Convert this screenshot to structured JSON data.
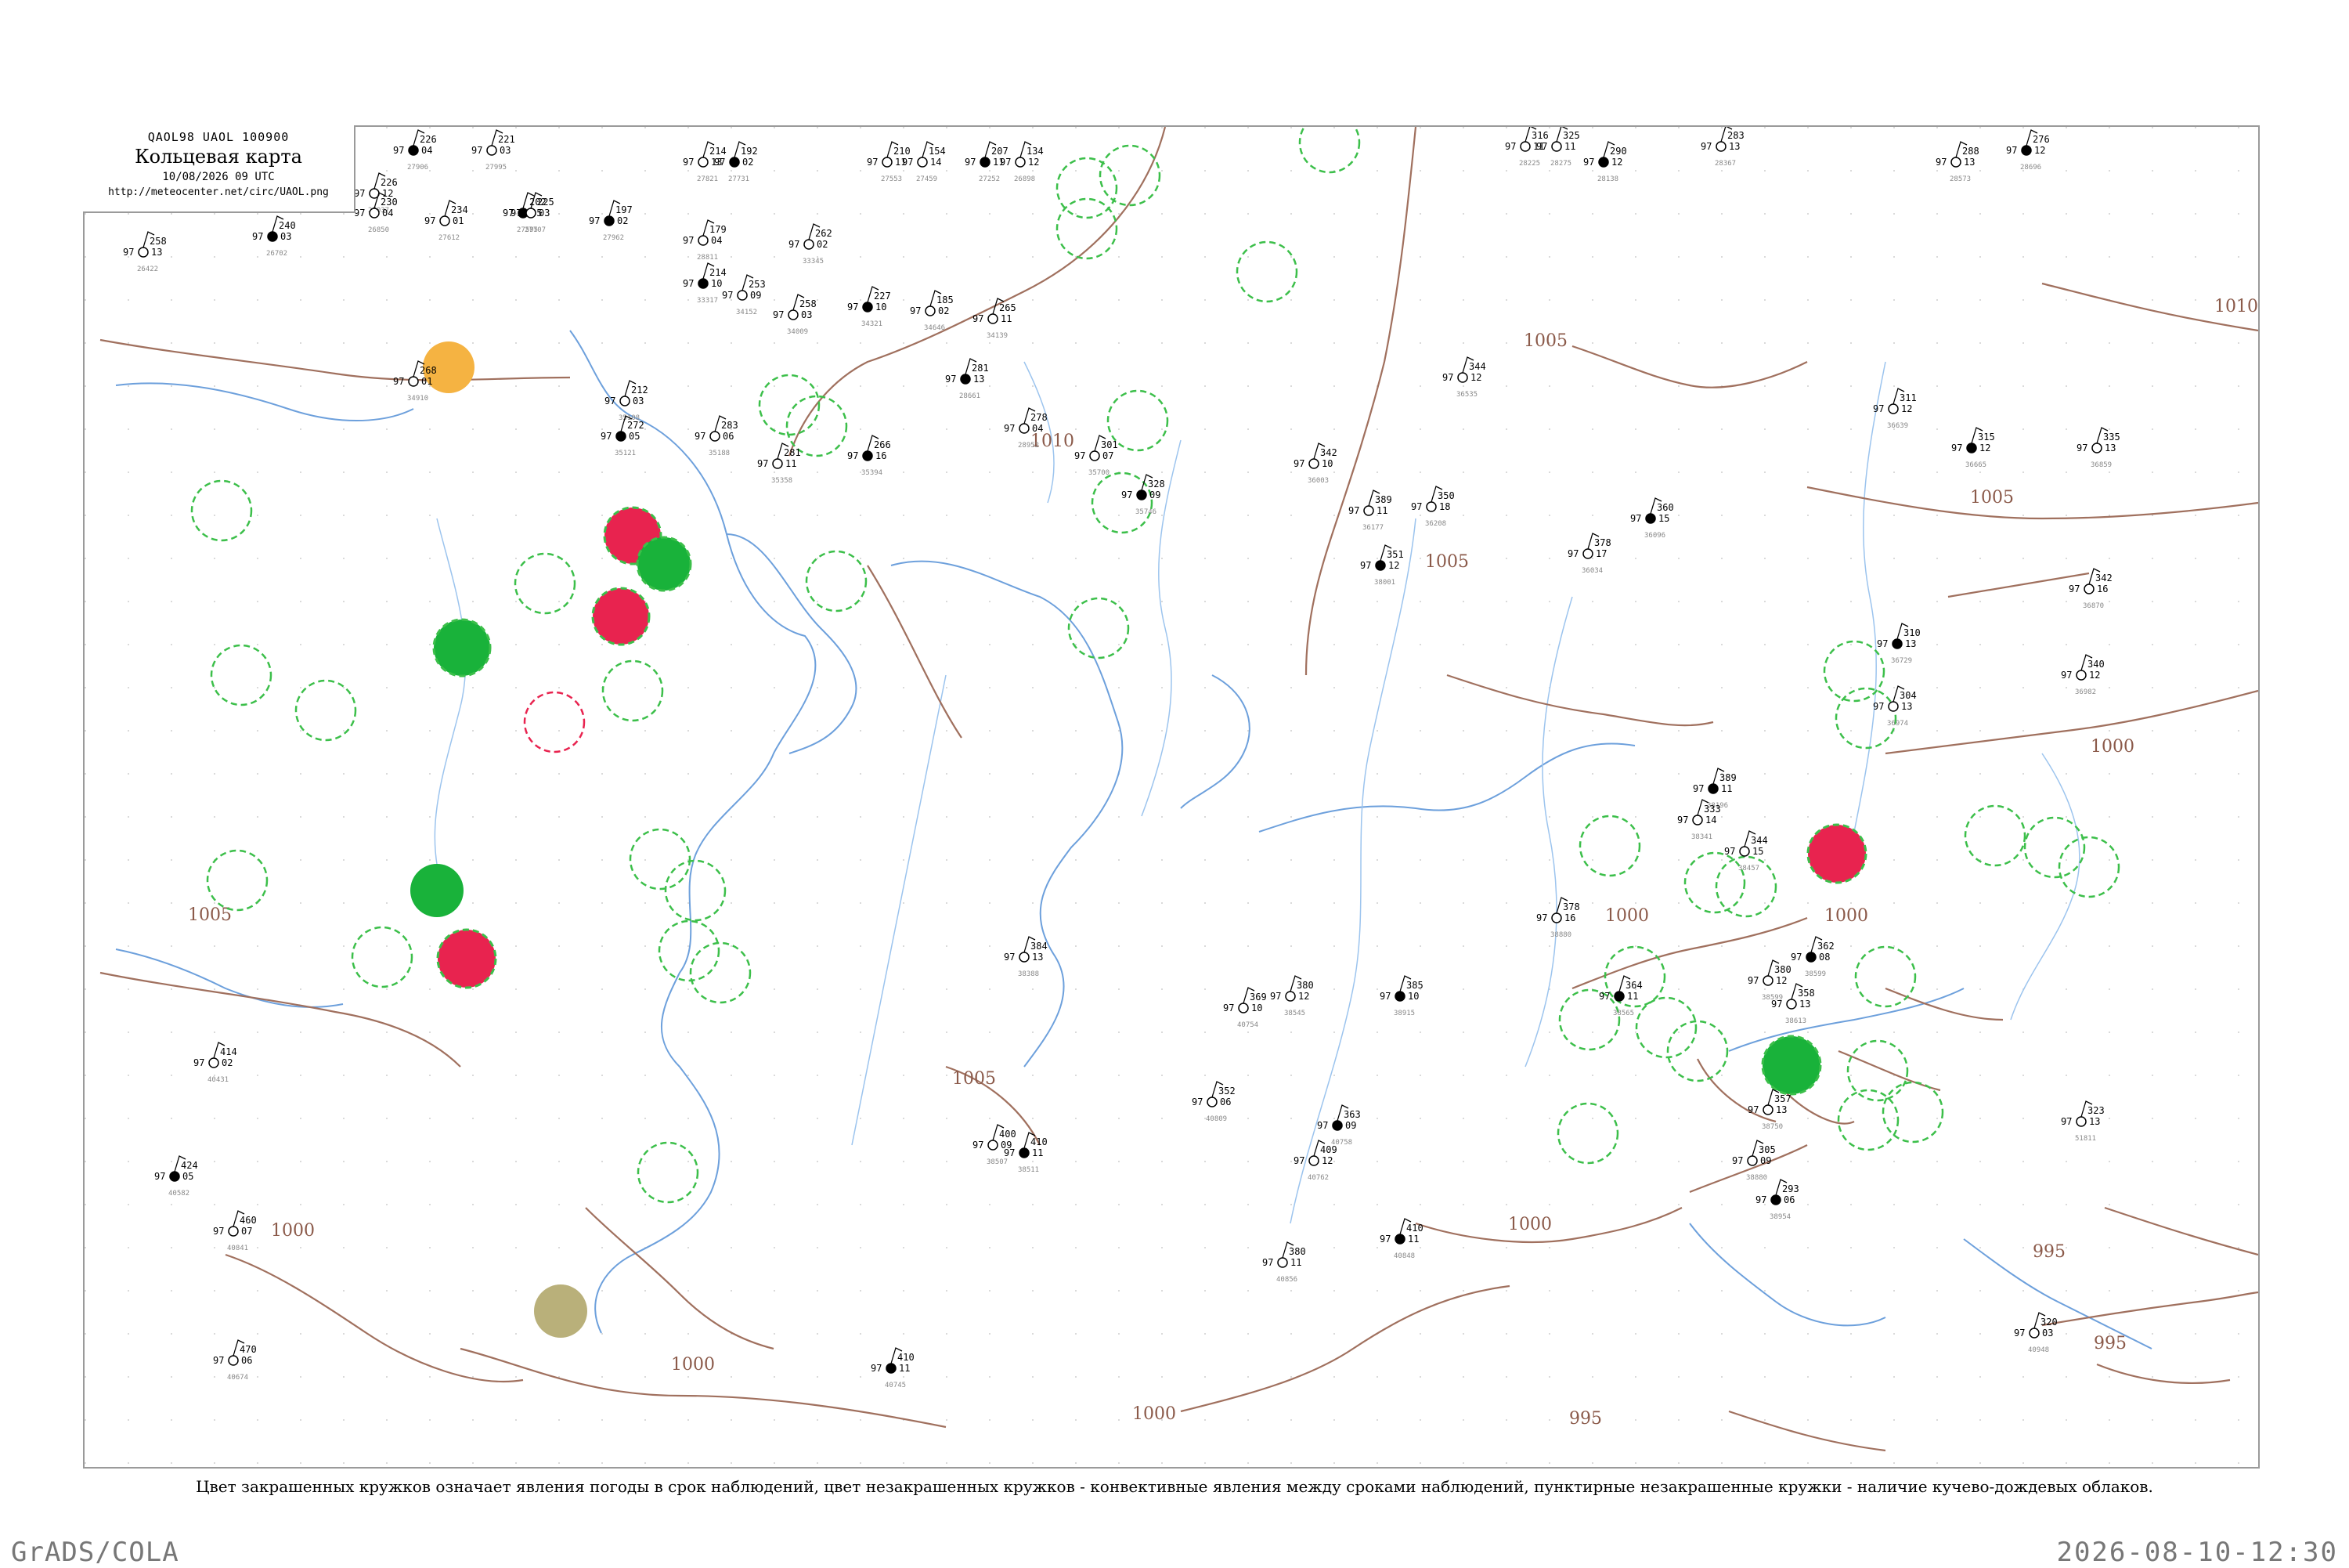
{
  "header": {
    "codes": "QAOL98  UAOL  100900",
    "title": "Кольцевая карта",
    "datetime": "10/08/2026 09 UTC",
    "url": "http://meteocenter.net/circ/UAOL.png"
  },
  "caption": "Цвет закрашенных кружков означает явления погоды в срок наблюдений, цвет незакрашенных кружков - конвективные явления между сроками наблюдений, пунктирные незакрашенные кружки - наличие кучево-дождевых облаков.",
  "footer": {
    "software": "GrADS/COLA",
    "timestamp": "2026-08-10-12:30"
  },
  "colors": {
    "isobar": "#a0705e",
    "river": "#7fb2e8",
    "coast": "#6da0dc",
    "thunder_fill": "#e8234f",
    "shower_fill": "#19b23a",
    "haze_fill": "#f5b342",
    "dust_fill": "#b9b07a",
    "cb_ring": "#3cbf4a"
  },
  "isobars": [
    {
      "label": "1010"
    },
    {
      "label": "1005"
    },
    {
      "label": "1005"
    },
    {
      "label": "1005"
    },
    {
      "label": "1005"
    },
    {
      "label": "1000"
    },
    {
      "label": "1000"
    },
    {
      "label": "1000"
    },
    {
      "label": "1000"
    },
    {
      "label": "1000"
    },
    {
      "label": "1000"
    },
    {
      "label": "995"
    },
    {
      "label": "995"
    },
    {
      "label": "995"
    },
    {
      "label": "1010"
    },
    {
      "label": "1005"
    },
    {
      "label": "1000"
    }
  ],
  "stations": [
    {
      "pressure": "226",
      "temp": "97",
      "dew": "04",
      "id": "27906"
    },
    {
      "pressure": "221",
      "temp": "97",
      "dew": "03",
      "id": "27995"
    },
    {
      "pressure": "214",
      "temp": "97",
      "dew": "13",
      "id": "27821"
    },
    {
      "pressure": "192",
      "temp": "97",
      "dew": "02",
      "id": "27731"
    },
    {
      "pressure": "210",
      "temp": "97",
      "dew": "11",
      "id": "27553"
    },
    {
      "pressure": "154",
      "temp": "97",
      "dew": "14",
      "id": "27459"
    },
    {
      "pressure": "207",
      "temp": "97",
      "dew": "11",
      "id": "27252"
    },
    {
      "pressure": "134",
      "temp": "97",
      "dew": "12",
      "id": "26898"
    },
    {
      "pressure": "226",
      "temp": "97",
      "dew": "12",
      "id": "27037"
    },
    {
      "pressure": "202",
      "temp": "97",
      "dew": "05",
      "id": "27595"
    },
    {
      "pressure": "316",
      "temp": "97",
      "dew": "11",
      "id": "28225"
    },
    {
      "pressure": "325",
      "temp": "97",
      "dew": "11",
      "id": "28275"
    },
    {
      "pressure": "290",
      "temp": "97",
      "dew": "12",
      "id": "28138"
    },
    {
      "pressure": "283",
      "temp": "97",
      "dew": "13",
      "id": "28367"
    },
    {
      "pressure": "288",
      "temp": "97",
      "dew": "13",
      "id": "28573"
    },
    {
      "pressure": "276",
      "temp": "97",
      "dew": "12",
      "id": "28696"
    },
    {
      "pressure": "258",
      "temp": "97",
      "dew": "13",
      "id": "26422"
    },
    {
      "pressure": "230",
      "temp": "97",
      "dew": "04",
      "id": "26850"
    },
    {
      "pressure": "240",
      "temp": "97",
      "dew": "03",
      "id": "26702"
    },
    {
      "pressure": "234",
      "temp": "97",
      "dew": "01",
      "id": "27612"
    },
    {
      "pressure": "225",
      "temp": "97",
      "dew": "03",
      "id": "27707"
    },
    {
      "pressure": "197",
      "temp": "97",
      "dew": "02",
      "id": "27962"
    },
    {
      "pressure": "179",
      "temp": "97",
      "dew": "04",
      "id": "28811"
    },
    {
      "pressure": "262",
      "temp": "97",
      "dew": "02",
      "id": "33345"
    },
    {
      "pressure": "214",
      "temp": "97",
      "dew": "10",
      "id": "33317"
    },
    {
      "pressure": "253",
      "temp": "97",
      "dew": "09",
      "id": "34152"
    },
    {
      "pressure": "258",
      "temp": "97",
      "dew": "03",
      "id": "34009"
    },
    {
      "pressure": "227",
      "temp": "97",
      "dew": "10",
      "id": "34321"
    },
    {
      "pressure": "185",
      "temp": "97",
      "dew": "02",
      "id": "34646"
    },
    {
      "pressure": "265",
      "temp": "97",
      "dew": "11",
      "id": "34139"
    },
    {
      "pressure": "281",
      "temp": "97",
      "dew": "13",
      "id": "28661"
    },
    {
      "pressure": "268",
      "temp": "97",
      "dew": "01",
      "id": "34910"
    },
    {
      "pressure": "212",
      "temp": "97",
      "dew": "03",
      "id": "35108"
    },
    {
      "pressure": "272",
      "temp": "97",
      "dew": "05",
      "id": "35121"
    },
    {
      "pressure": "283",
      "temp": "97",
      "dew": "06",
      "id": "35188"
    },
    {
      "pressure": "281",
      "temp": "97",
      "dew": "11",
      "id": "35358"
    },
    {
      "pressure": "266",
      "temp": "97",
      "dew": "16",
      "id": "35394"
    },
    {
      "pressure": "278",
      "temp": "97",
      "dew": "04",
      "id": "28952"
    },
    {
      "pressure": "301",
      "temp": "97",
      "dew": "07",
      "id": "35700"
    },
    {
      "pressure": "328",
      "temp": "97",
      "dew": "09",
      "id": "35746"
    },
    {
      "pressure": "342",
      "temp": "97",
      "dew": "10",
      "id": "36003"
    },
    {
      "pressure": "389",
      "temp": "97",
      "dew": "11",
      "id": "36177"
    },
    {
      "pressure": "351",
      "temp": "97",
      "dew": "12",
      "id": "38001"
    },
    {
      "pressure": "350",
      "temp": "97",
      "dew": "18",
      "id": "36208"
    },
    {
      "pressure": "378",
      "temp": "97",
      "dew": "17",
      "id": "36034"
    },
    {
      "pressure": "360",
      "temp": "97",
      "dew": "15",
      "id": "36096"
    },
    {
      "pressure": "344",
      "temp": "97",
      "dew": "12",
      "id": "36535"
    },
    {
      "pressure": "311",
      "temp": "97",
      "dew": "12",
      "id": "36639"
    },
    {
      "pressure": "315",
      "temp": "97",
      "dew": "12",
      "id": "36665"
    },
    {
      "pressure": "335",
      "temp": "97",
      "dew": "13",
      "id": "36859"
    },
    {
      "pressure": "342",
      "temp": "97",
      "dew": "16",
      "id": "36870"
    },
    {
      "pressure": "310",
      "temp": "97",
      "dew": "13",
      "id": "36729"
    },
    {
      "pressure": "304",
      "temp": "97",
      "dew": "13",
      "id": "36974"
    },
    {
      "pressure": "340",
      "temp": "97",
      "dew": "12",
      "id": "36982"
    },
    {
      "pressure": "389",
      "temp": "97",
      "dew": "11",
      "id": "38196"
    },
    {
      "pressure": "333",
      "temp": "97",
      "dew": "14",
      "id": "38341"
    },
    {
      "pressure": "344",
      "temp": "97",
      "dew": "15",
      "id": "38457"
    },
    {
      "pressure": "362",
      "temp": "97",
      "dew": "08",
      "id": "38599"
    },
    {
      "pressure": "358",
      "temp": "97",
      "dew": "13",
      "id": "38613"
    },
    {
      "pressure": "380",
      "temp": "97",
      "dew": "12",
      "id": "38599"
    },
    {
      "pressure": "364",
      "temp": "97",
      "dew": "11",
      "id": "38565"
    },
    {
      "pressure": "357",
      "temp": "97",
      "dew": "13",
      "id": "38750"
    },
    {
      "pressure": "305",
      "temp": "97",
      "dew": "09",
      "id": "38880"
    },
    {
      "pressure": "293",
      "temp": "97",
      "dew": "06",
      "id": "38954"
    },
    {
      "pressure": "323",
      "temp": "97",
      "dew": "13",
      "id": "51811"
    },
    {
      "pressure": "320",
      "temp": "97",
      "dew": "03",
      "id": "40948"
    },
    {
      "pressure": "410",
      "temp": "97",
      "dew": "11",
      "id": "40745"
    },
    {
      "pressure": "369",
      "temp": "97",
      "dew": "10",
      "id": "40754"
    },
    {
      "pressure": "352",
      "temp": "97",
      "dew": "06",
      "id": "40809"
    },
    {
      "pressure": "363",
      "temp": "97",
      "dew": "09",
      "id": "40758"
    },
    {
      "pressure": "380",
      "temp": "97",
      "dew": "11",
      "id": "40856"
    },
    {
      "pressure": "409",
      "temp": "97",
      "dew": "12",
      "id": "40762"
    },
    {
      "pressure": "410",
      "temp": "97",
      "dew": "11",
      "id": "40848"
    },
    {
      "pressure": "460",
      "temp": "97",
      "dew": "07",
      "id": "40841"
    },
    {
      "pressure": "470",
      "temp": "97",
      "dew": "06",
      "id": "40674"
    },
    {
      "pressure": "424",
      "temp": "97",
      "dew": "05",
      "id": "40582"
    },
    {
      "pressure": "414",
      "temp": "97",
      "dew": "02",
      "id": "40431"
    },
    {
      "pressure": "400",
      "temp": "97",
      "dew": "09",
      "id": "38507"
    },
    {
      "pressure": "410",
      "temp": "97",
      "dew": "11",
      "id": "38511"
    },
    {
      "pressure": "384",
      "temp": "97",
      "dew": "13",
      "id": "38388"
    },
    {
      "pressure": "380",
      "temp": "97",
      "dew": "12",
      "id": "38545"
    },
    {
      "pressure": "385",
      "temp": "97",
      "dew": "10",
      "id": "38915"
    },
    {
      "pressure": "378",
      "temp": "97",
      "dew": "16",
      "id": "38880"
    }
  ]
}
